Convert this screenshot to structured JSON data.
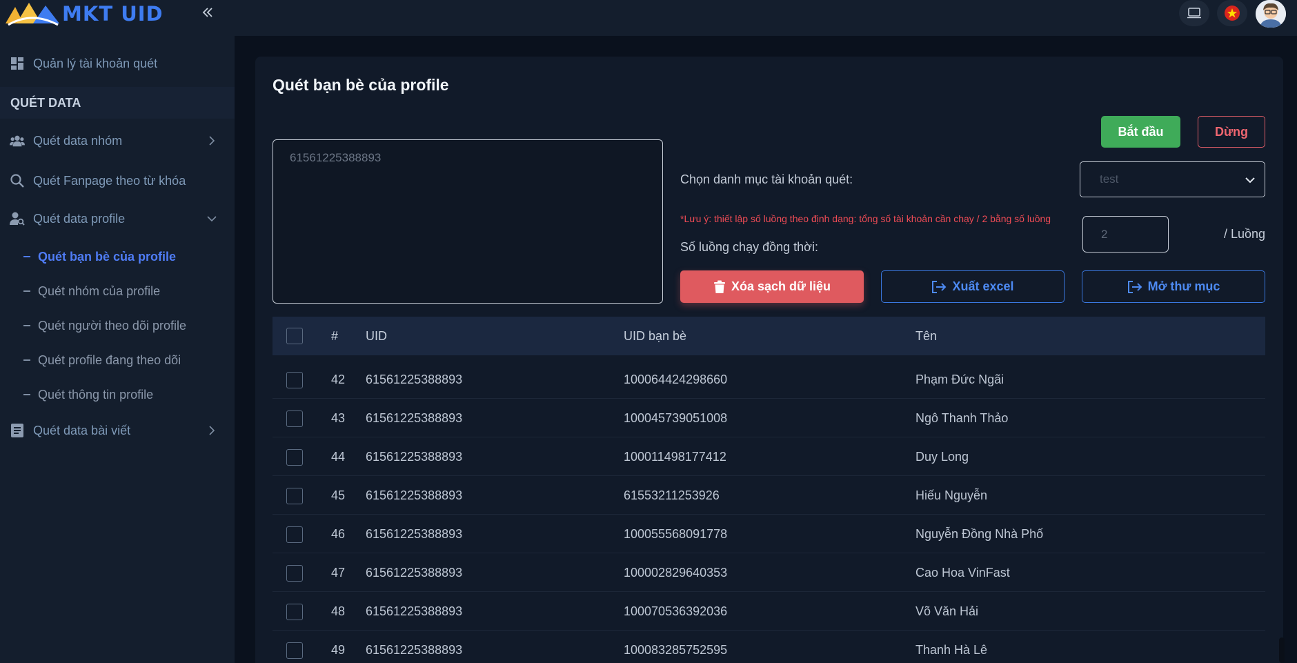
{
  "app": {
    "logo_text": "MKT UID"
  },
  "sidebar": {
    "account_manage": "Quản lý tài khoản quét",
    "section_title": "QUÉT DATA",
    "group_data": "Quét data nhóm",
    "fanpage_keyword": "Quét Fanpage theo từ khóa",
    "profile_data": "Quét data profile",
    "sub_items": [
      "Quét bạn bè của profile",
      "Quét nhóm của profile",
      "Quét người theo dõi profile",
      "Quét profile đang theo dõi",
      "Quét thông tin profile"
    ],
    "post_data": "Quét data bài viết"
  },
  "main": {
    "title": "Quét bạn bè của profile",
    "textarea_value": "61561225388893",
    "start_label": "Bắt đầu",
    "stop_label": "Dừng",
    "category_label": "Chọn danh mục tài khoản quét:",
    "category_value": "test",
    "note": "*Lưu ý: thiết lập số luồng theo định dạng: tổng số tài khoản cần chạy / 2 bằng số luồng",
    "threads_label": "Số luồng chạy đồng thời:",
    "threads_value": "2",
    "threads_unit": "/ Luồng",
    "clear_label": "Xóa sạch dữ liệu",
    "export_label": "Xuất excel",
    "open_folder_label": "Mở thư mục"
  },
  "table": {
    "headers": {
      "index": "#",
      "uid": "UID",
      "friend_uid": "UID bạn bè",
      "name": "Tên"
    },
    "rows": [
      {
        "index": "42",
        "uid": "61561225388893",
        "friend_uid": "100064424298660",
        "name": "Phạm Đức Ngãi"
      },
      {
        "index": "43",
        "uid": "61561225388893",
        "friend_uid": "100045739051008",
        "name": "Ngô Thanh Thảo"
      },
      {
        "index": "44",
        "uid": "61561225388893",
        "friend_uid": "100011498177412",
        "name": "Duy Long"
      },
      {
        "index": "45",
        "uid": "61561225388893",
        "friend_uid": "61553211253926",
        "name": "Hiếu Nguyễn"
      },
      {
        "index": "46",
        "uid": "61561225388893",
        "friend_uid": "100055568091778",
        "name": "Nguyễn Đồng Nhà Phố"
      },
      {
        "index": "47",
        "uid": "61561225388893",
        "friend_uid": "100002829640353",
        "name": "Cao Hoa VinFast"
      },
      {
        "index": "48",
        "uid": "61561225388893",
        "friend_uid": "100070536392036",
        "name": "Võ Văn Hải"
      },
      {
        "index": "49",
        "uid": "61561225388893",
        "friend_uid": "100083285752595",
        "name": "Thanh Hà Lê"
      }
    ]
  },
  "colors": {
    "accent": "#4f7cf5",
    "success": "#3fab59",
    "danger": "#df5a5f"
  }
}
